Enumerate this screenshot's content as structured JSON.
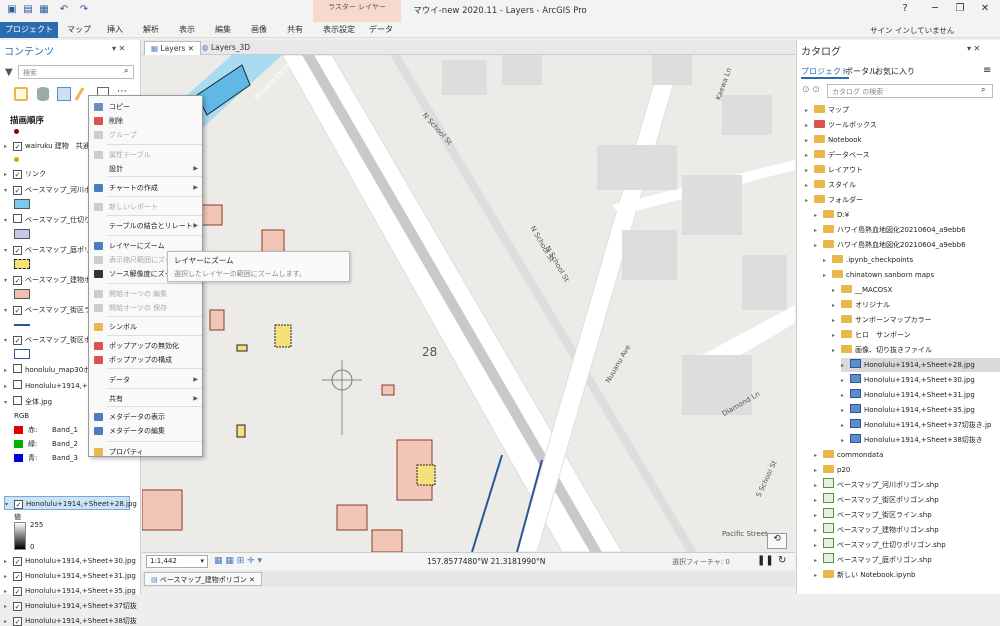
{
  "title": "マウイ-new 2020.11 - Layers - ArcGIS Pro",
  "ribbon": {
    "context_group": "ラスター レイヤー",
    "tabs": [
      "プロジェクト",
      "マップ",
      "挿入",
      "解析",
      "表示",
      "編集",
      "画像",
      "共有",
      "表示設定",
      "データ"
    ]
  },
  "signin": "サイン インしていません",
  "contents": {
    "title": "コンテンツ",
    "search_placeholder": "検索",
    "draw_order": "描画順序",
    "layers": [
      {
        "label": "wairuku 建物　共通",
        "checked": true
      },
      {
        "label": "リンク",
        "checked": true
      },
      {
        "label": "ベースマップ_河川ポリゴ",
        "checked": true
      },
      {
        "label": "ベースマップ_仕切りポリ",
        "checked": false
      },
      {
        "label": "ベースマップ_庭ポリゴン",
        "checked": true
      },
      {
        "label": "ベースマップ_建物ポリゴ",
        "checked": true
      },
      {
        "label": "ベースマップ_街区ライン",
        "checked": true
      },
      {
        "label": "ベースマップ_街区ポリゴ",
        "checked": true
      },
      {
        "label": "honolulu_map30ポリ",
        "checked": false
      },
      {
        "label": "Honolulu+1914,+Sh",
        "checked": false
      },
      {
        "label": "全体.jpg",
        "checked": false
      }
    ],
    "rgb_label": "RGB",
    "bands": [
      {
        "ch": "赤:",
        "name": "Band_1",
        "color": "#e00000"
      },
      {
        "ch": "緑:",
        "name": "Band_2",
        "color": "#00b000"
      },
      {
        "ch": "青:",
        "name": "Band_3",
        "color": "#0000e0"
      }
    ],
    "selected_layer": "Honolulu+1914,+Sheet+28.jpg",
    "value_label": "値",
    "value_max": "255",
    "value_min": "0",
    "more_layers": [
      "Honolulu+1914,+Sheet+30.jpg",
      "Honolulu+1914,+Sheet+31.jpg",
      "Honolulu+1914,+Sheet+35.jpg",
      "Honolulu+1914,+Sheet+37切抜",
      "Honolulu+1914,+Sheet+38切抜"
    ]
  },
  "map": {
    "tabs": [
      "Layers",
      "Layers_3D"
    ],
    "scale": "1:1,442",
    "coords": "157.8577480°W 21.3181990°N",
    "selected_features": "選択フィーチャ: 0",
    "streets": [
      "N School St",
      "N School St",
      "N School St",
      "Nuuanu Stream",
      "Kaewa Ln",
      "Nuuanu Ave",
      "Diamond Ln",
      "S School St",
      "Pacific Street"
    ],
    "sheet_number": "28"
  },
  "context_menu": {
    "items": [
      {
        "label": "コピー",
        "disabled": false,
        "submenu": false,
        "color": "#6a8fbf"
      },
      {
        "label": "削除",
        "disabled": false,
        "submenu": false,
        "color": "#d9534f"
      },
      {
        "label": "グループ",
        "disabled": true,
        "submenu": false,
        "color": "#ccc"
      },
      {
        "label": "属性テーブル",
        "disabled": true,
        "submenu": false,
        "color": "#ccc"
      },
      {
        "label": "設計",
        "disabled": false,
        "submenu": true,
        "color": ""
      },
      {
        "label": "チャートの作成",
        "disabled": false,
        "submenu": true,
        "color": "#4a7dbf"
      },
      {
        "label": "新しいレポート",
        "disabled": true,
        "submenu": false,
        "color": "#ccc"
      },
      {
        "label": "テーブルの結合とリレート",
        "disabled": false,
        "submenu": true,
        "color": ""
      },
      {
        "label": "レイヤーにズーム",
        "disabled": false,
        "submenu": false,
        "color": "#4a7dbf"
      },
      {
        "label": "表示縮尺範囲にズーム",
        "disabled": true,
        "submenu": false,
        "color": "#ccc"
      },
      {
        "label": "ソース解像度にズーム",
        "disabled": false,
        "submenu": false,
        "color": "#333"
      },
      {
        "label": "開始オーツの 編集",
        "disabled": true,
        "submenu": false,
        "color": "#ccc"
      },
      {
        "label": "開始オーツの 保存",
        "disabled": true,
        "submenu": false,
        "color": "#ccc"
      },
      {
        "label": "シンボル",
        "disabled": false,
        "submenu": false,
        "color": "#e8b84b"
      },
      {
        "label": "ポップアップの無効化",
        "disabled": false,
        "submenu": false,
        "color": "#d9534f"
      },
      {
        "label": "ポップアップの構成",
        "disabled": false,
        "submenu": false,
        "color": "#d9534f"
      },
      {
        "label": "データ",
        "disabled": false,
        "submenu": true,
        "color": ""
      },
      {
        "label": "共有",
        "disabled": false,
        "submenu": true,
        "color": ""
      },
      {
        "label": "メタデータの表示",
        "disabled": false,
        "submenu": false,
        "color": "#4a7dbf"
      },
      {
        "label": "メタデータの編集",
        "disabled": false,
        "submenu": false,
        "color": "#4a7dbf"
      },
      {
        "label": "プロパティ",
        "disabled": false,
        "submenu": false,
        "color": "#e8b84b"
      }
    ]
  },
  "tooltip": {
    "title": "レイヤーにズーム",
    "desc": "選択したレイヤーの範囲にズームします。"
  },
  "catalog": {
    "title": "カタログ",
    "tabs": [
      "プロジェクト",
      "ポータル",
      "お気に入り"
    ],
    "search_placeholder": "カタログ の検索",
    "items": [
      {
        "label": "マップ",
        "indent": 0,
        "icon": "map"
      },
      {
        "label": "ツールボックス",
        "indent": 0,
        "icon": "toolbox"
      },
      {
        "label": "Notebook",
        "indent": 0,
        "icon": "notebook"
      },
      {
        "label": "データベース",
        "indent": 0,
        "icon": "db"
      },
      {
        "label": "レイアウト",
        "indent": 0,
        "icon": "layout"
      },
      {
        "label": "スタイル",
        "indent": 0,
        "icon": "style"
      },
      {
        "label": "フォルダー",
        "indent": 0,
        "icon": "folder"
      },
      {
        "label": "D:¥",
        "indent": 1,
        "icon": "folder"
      },
      {
        "label": "ハワイ島熱血地図化20210604_a9ebb6",
        "indent": 1,
        "icon": "folder"
      },
      {
        "label": "ハワイ島熱血地図化20210604_a9ebb6",
        "indent": 1,
        "icon": "folder"
      },
      {
        "label": ".ipynb_checkpoints",
        "indent": 2,
        "icon": "folder"
      },
      {
        "label": "chinatown sanborn maps",
        "indent": 2,
        "icon": "folder"
      },
      {
        "label": "__MACOSX",
        "indent": 3,
        "icon": "folder"
      },
      {
        "label": "オリジナル",
        "indent": 3,
        "icon": "folder"
      },
      {
        "label": "サンボーンマップカラー",
        "indent": 3,
        "icon": "folder"
      },
      {
        "label": "ヒロ　サンボーン",
        "indent": 3,
        "icon": "folder"
      },
      {
        "label": "画像、切り抜きファイル",
        "indent": 3,
        "icon": "folder"
      },
      {
        "label": "Honolulu+1914,+Sheet+28.jpg",
        "indent": 4,
        "icon": "img",
        "selected": true
      },
      {
        "label": "Honolulu+1914,+Sheet+30.jpg",
        "indent": 4,
        "icon": "img"
      },
      {
        "label": "Honolulu+1914,+Sheet+31.jpg",
        "indent": 4,
        "icon": "img"
      },
      {
        "label": "Honolulu+1914,+Sheet+35.jpg",
        "indent": 4,
        "icon": "img"
      },
      {
        "label": "Honolulu+1914,+Sheet+37切抜き.jp",
        "indent": 4,
        "icon": "img"
      },
      {
        "label": "Honolulu+1914,+Sheet+38切抜き",
        "indent": 4,
        "icon": "img"
      },
      {
        "label": "commondata",
        "indent": 1,
        "icon": "folder"
      },
      {
        "label": "p20",
        "indent": 1,
        "icon": "folder"
      },
      {
        "label": "ベースマップ_河川ポリゴン.shp",
        "indent": 1,
        "icon": "shp"
      },
      {
        "label": "ベースマップ_街区ポリゴン.shp",
        "indent": 1,
        "icon": "shp"
      },
      {
        "label": "ベースマップ_街区ライン.shp",
        "indent": 1,
        "icon": "shp"
      },
      {
        "label": "ベースマップ_建物ポリゴン.shp",
        "indent": 1,
        "icon": "shp"
      },
      {
        "label": "ベースマップ_仕切りポリゴン.shp",
        "indent": 1,
        "icon": "shp"
      },
      {
        "label": "ベースマップ_庭ポリゴン.shp",
        "indent": 1,
        "icon": "shp"
      },
      {
        "label": "新しい Notebook.ipynb",
        "indent": 1,
        "icon": "notebook"
      }
    ]
  },
  "bottom_tab": "ベースマップ_建物ポリゴン"
}
